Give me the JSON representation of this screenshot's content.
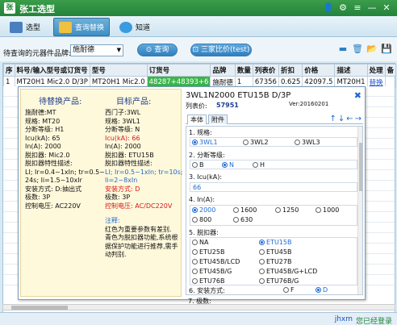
{
  "app": {
    "logo_text": "张",
    "title": "张工选型"
  },
  "nav": {
    "tabs": [
      {
        "label": "选型"
      },
      {
        "label": "查询替换"
      },
      {
        "label": "知道"
      }
    ]
  },
  "toolbar": {
    "label": "待查询的元器件品牌:",
    "brand_value": "施耐德",
    "query_button": "查询",
    "compare_button": "三家比价(test)"
  },
  "table": {
    "headers": [
      "序",
      "料号/输入型号或订货号",
      "型号",
      "订货号",
      "品牌",
      "数量",
      "列表价",
      "折扣",
      "价格",
      "描述",
      "处理",
      "备"
    ],
    "row": {
      "index": "1",
      "input_model": "MT20H1 Mic2.0 D/3P",
      "model": "MT20H1 Mic2.0",
      "order_no": "48287+48393+6",
      "brand": "施耐德",
      "qty": "1",
      "list_price": "67356",
      "discount": "0.625",
      "price": "42097.5",
      "description": "MT20H1",
      "action": "替换"
    }
  },
  "popup": {
    "left": {
      "head_left": "待替换产品:",
      "head_right": "目标产品:",
      "left_lines": [
        "施耐德:MT",
        "规格: MT20",
        "分断等级: H1",
        "Icu(kA): 65",
        "In(A): 2000",
        "脱扣器: Mic2.0",
        "脱扣器特性描述:",
        "LI; Ir=0.4~1xIn; tr=0.5~",
        "24s; Ii=1.5~10xIr",
        "安装方式: D:抽出式",
        "极数: 3P",
        "控制电压: AC220V"
      ],
      "right_lines": [
        "西门子:3WL",
        "规格: 3WL1",
        "分断等级: N",
        "Icu(kA): 66",
        "In(A): 2000",
        "脱扣器: ETU15B",
        "脱扣器特性描述:",
        "LI; Ir=0.5~1xIn; tr=10s;",
        "Ii=2~8xIn",
        "安装方式: D",
        "极数: 3P",
        "控制电压: AC/DC220V"
      ],
      "note_title": "注释:",
      "note_lines": [
        "红色为重要参数有差别.",
        "",
        "青色为脱扣器功能,系统根",
        "据保护功能进行推荐,需手",
        "动判别."
      ]
    },
    "right": {
      "title": "3WL1N2000 ETU15B D/3P",
      "price_label": "列表价:",
      "price_value": "57951",
      "version": "Ver:20160201",
      "subtabs": [
        "本体",
        "附件"
      ],
      "arrows": "↑↓←→",
      "params": [
        {
          "name": "1. 规格:",
          "options": [
            "3WL1",
            "3WL2",
            "3WL3"
          ],
          "selected": "3WL1"
        },
        {
          "name": "2. 分断等级:",
          "options": [
            "B",
            "N",
            "H"
          ],
          "selected": "N"
        },
        {
          "name": "3. Icu(kA):",
          "value": "66"
        },
        {
          "name": "4. In(A):",
          "options": [
            "2000",
            "1600",
            "1250",
            "1000",
            "800",
            "630"
          ],
          "selected": "2000"
        },
        {
          "name": "5. 脱扣器:",
          "options": [
            "NA",
            "ETU15B",
            "ETU25B",
            "ETU45B",
            "ETU45B/LCD",
            "ETU27B",
            "ETU45B/G",
            "ETU45B/G+LCD",
            "ETU76B",
            "ETU76B/G"
          ],
          "selected": "ETU15B"
        },
        {
          "name": "6. 安装方式:",
          "options": [
            "F",
            "D"
          ],
          "selected": "D"
        },
        {
          "name": "7. 极数:"
        }
      ]
    }
  },
  "status": {
    "user": "jhxm",
    "login": "您已经登录"
  }
}
